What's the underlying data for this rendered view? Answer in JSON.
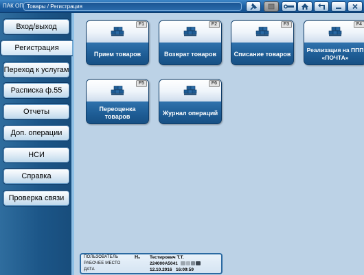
{
  "titlebar": {
    "app_name": "ПАК ОПС",
    "breadcrumb": "Товары / Регистрация",
    "buttons": [
      {
        "name": "pin-button",
        "icon": "pin-icon"
      },
      {
        "name": "disabled-button",
        "icon": "blank-icon"
      },
      {
        "name": "tools-button",
        "icon": "wrench-icon"
      },
      {
        "name": "home-button",
        "icon": "home-icon"
      },
      {
        "name": "back-button",
        "icon": "return-arrow-icon"
      },
      {
        "name": "minimize-button",
        "icon": "minimize-icon"
      },
      {
        "name": "close-button",
        "icon": "close-icon"
      }
    ]
  },
  "sidebar": {
    "items": [
      {
        "label": "Вход/выход",
        "active": false
      },
      {
        "label": "Регистрация",
        "active": true
      },
      {
        "label": "Переход к услугам",
        "active": false
      },
      {
        "label": "Расписка ф.55",
        "active": false
      },
      {
        "label": "Отчеты",
        "active": false
      },
      {
        "label": "Доп. операции",
        "active": false
      },
      {
        "label": "НСИ",
        "active": false
      },
      {
        "label": "Справка",
        "active": false
      },
      {
        "label": "Проверка связи",
        "active": false
      }
    ]
  },
  "tiles": [
    {
      "hotkey": "F1",
      "label": "Прием товаров",
      "icon": "boxes-icon"
    },
    {
      "hotkey": "F2",
      "label": "Возврат товаров",
      "icon": "boxes-icon"
    },
    {
      "hotkey": "F3",
      "label": "Списание товаров",
      "icon": "boxes-icon"
    },
    {
      "hotkey": "F4",
      "label": "Реализация на ППП «ПОЧТА»",
      "icon": "boxes-icon"
    },
    {
      "hotkey": "F5",
      "label": "Переоценка товаров",
      "icon": "boxes-icon"
    },
    {
      "hotkey": "F6",
      "label": "Журнал операций",
      "icon": "boxes-icon"
    }
  ],
  "status": {
    "user_label": "ПОЛЬЗОВАТЕЛЬ",
    "user_badge": "H₆",
    "user_value": "Тестирович Т.Т.",
    "workplace_label": "РАБОЧЕЕ МЕСТО",
    "workplace_value": "224000A5041",
    "date_label": "ДАТА",
    "date_value": "12.10.2016   16:09:59"
  },
  "colors": {
    "titlebar": "#1f63a6",
    "sidebar": "#1c5688",
    "main_background": "#bcd2e6",
    "tile_bottom": "#1c5a92"
  }
}
